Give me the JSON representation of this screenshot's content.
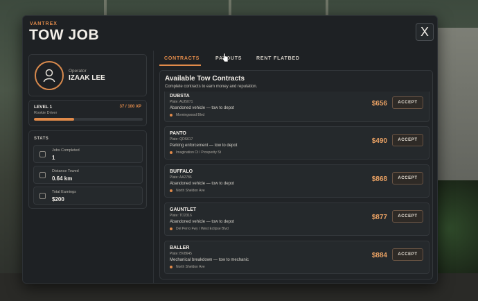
{
  "app": {
    "brand": "VANTREX",
    "title": "TOW JOB",
    "close_glyph": "X"
  },
  "operator": {
    "label": "Operator",
    "name": "IZAAK LEE"
  },
  "level": {
    "label": "LEVEL 1",
    "rank": "Rookie Driver",
    "xp_text": "37 / 100 XP",
    "xp_progress": 0.37
  },
  "stats": {
    "title": "STATS",
    "items": [
      {
        "label": "Jobs Completed",
        "value": "1",
        "icon": "id-card-icon"
      },
      {
        "label": "Distance Towed",
        "value": "0.64 km",
        "icon": "route-icon"
      },
      {
        "label": "Total Earnings",
        "value": "$200",
        "icon": "cash-icon"
      }
    ]
  },
  "tabs": [
    {
      "label": "CONTRACTS",
      "active": true
    },
    {
      "label": "PAYOUTS",
      "active": false
    },
    {
      "label": "RENT FLATBED",
      "active": false
    }
  ],
  "contracts": {
    "title": "Available Tow Contracts",
    "subtitle": "Complete contracts to earn money and reputation.",
    "accept_label": "ACCEPT",
    "items": [
      {
        "name": "DUBSTA",
        "plate": "Plate: AUI5071",
        "desc": "Abandoned vehicle — tow to depot",
        "location": "Morningwood Blvd",
        "price": "$656"
      },
      {
        "name": "PANTO",
        "plate": "Plate: QDS617",
        "desc": "Parking enforcement — tow to depot",
        "location": "Imagination Ct / Prosperity St",
        "price": "$490"
      },
      {
        "name": "BUFFALO",
        "plate": "Plate: AA2786",
        "desc": "Abandoned vehicle — tow to depot",
        "location": "North Sheldon Ave",
        "price": "$868"
      },
      {
        "name": "GAUNTLET",
        "plate": "Plate: TD2316",
        "desc": "Abandoned vehicle — tow to depot",
        "location": "Del Perro Fwy / West Eclipse Blvd",
        "price": "$877"
      },
      {
        "name": "BALLER",
        "plate": "Plate: BV8645",
        "desc": "Mechanical breakdown — tow to mechanic",
        "location": "North Sheldon Ave",
        "price": "$884"
      }
    ]
  },
  "colors": {
    "accent": "#e08a4a",
    "panel": "#1e2124",
    "card": "#212427"
  }
}
